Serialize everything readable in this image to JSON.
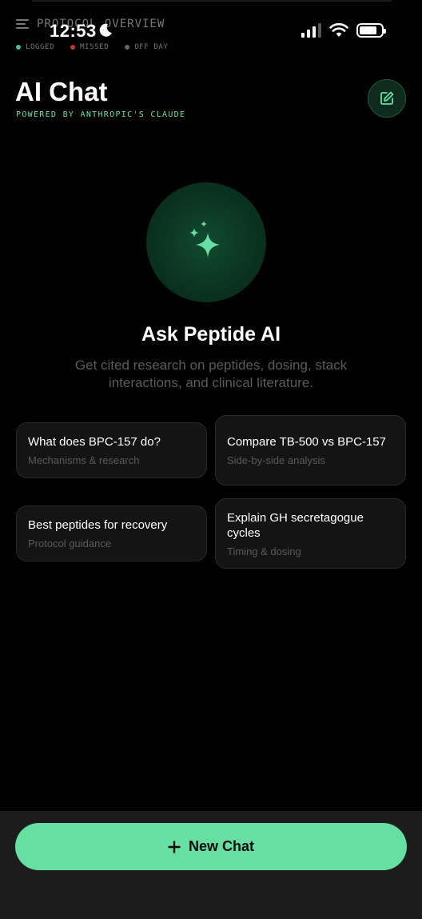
{
  "status_bar": {
    "time": "12:53",
    "context_label": "PROTOCOL OVERVIEW",
    "legend": [
      {
        "label": "LOGGED",
        "color": "#4fbf87"
      },
      {
        "label": "MISSED",
        "color": "#c0392b"
      },
      {
        "label": "OFF DAY",
        "color": "#666666"
      }
    ]
  },
  "header": {
    "title": "AI Chat",
    "subtitle": "POWERED BY ANTHROPIC'S CLAUDE"
  },
  "hero": {
    "title": "Ask Peptide AI",
    "description": "Get cited research on peptides, dosing, stack interactions, and clinical literature."
  },
  "suggestions": [
    {
      "title": "What does BPC-157 do?",
      "subtitle": "Mechanisms & research"
    },
    {
      "title": "Compare TB-500 vs BPC-157",
      "subtitle": "Side-by-side analysis"
    },
    {
      "title": "Best peptides for recovery",
      "subtitle": "Protocol guidance"
    },
    {
      "title": "Explain GH secretagogue cycles",
      "subtitle": "Timing & dosing"
    }
  ],
  "footer": {
    "new_chat_label": "New Chat"
  },
  "colors": {
    "accent": "#65e0a2",
    "background": "#000000",
    "card": "#141414"
  },
  "icons": {
    "compose": "compose-icon",
    "sparkles": "sparkles-icon",
    "plus": "plus-icon"
  }
}
